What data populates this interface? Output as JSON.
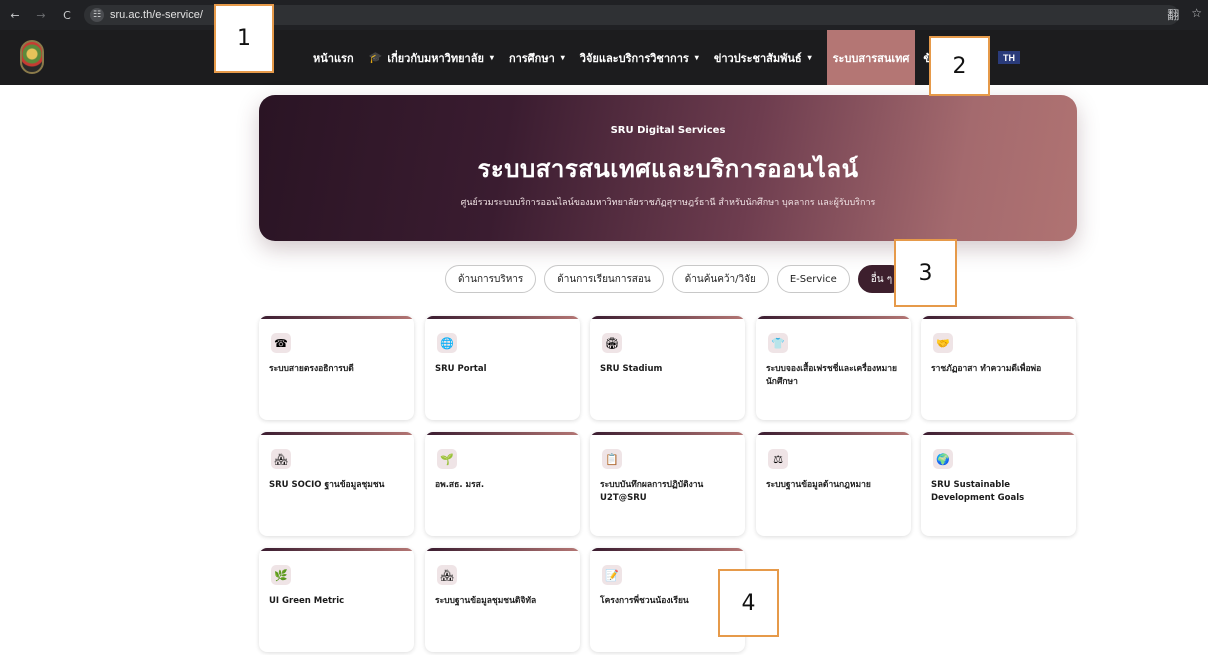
{
  "browser": {
    "url": "sru.ac.th/e-service/",
    "back_icon": "←",
    "forward_icon": "→",
    "reload_icon": "C",
    "site_info_icon": "☷",
    "translate_icon": "翻",
    "star_icon": "☆"
  },
  "nav": {
    "items": [
      {
        "label": "หน้าแรก"
      },
      {
        "label": "เกี่ยวกับมหาวิทยาลัย",
        "icon": "🎓",
        "caret": "▾"
      },
      {
        "label": "การศึกษา",
        "caret": "▾"
      },
      {
        "label": "วิจัยและบริการวิชาการ",
        "caret": "▾"
      },
      {
        "label": "ข่าวประชาสัมพันธ์",
        "caret": "▾"
      },
      {
        "label": "ระบบสารสนเทศ"
      },
      {
        "label": "ข้อ"
      }
    ],
    "lang_label": "TH"
  },
  "hero": {
    "eyebrow": "SRU Digital Services",
    "title": "ระบบสารสนเทศและบริการออนไลน์",
    "subtitle": "ศูนย์รวมระบบบริการออนไลน์ของมหาวิทยาลัยราชภัฏสุราษฎร์ธานี สำหรับนักศึกษา บุคลากร และผู้รับบริการ"
  },
  "filters": [
    {
      "label": "ด้านการบริหาร"
    },
    {
      "label": "ด้านการเรียนการสอน"
    },
    {
      "label": "ด้านค้นคว้า/วิจัย"
    },
    {
      "label": "E-Service"
    },
    {
      "label": "อื่น ๆ",
      "active": true
    }
  ],
  "cards": [
    {
      "icon": "☎",
      "label": "ระบบสายตรงอธิการบดี"
    },
    {
      "icon": "🌐",
      "label": "SRU Portal"
    },
    {
      "icon": "🏟",
      "label": "SRU Stadium"
    },
    {
      "icon": "👕",
      "label": "ระบบจองเสื้อเฟรชชี่และเครื่องหมายนักศึกษา"
    },
    {
      "icon": "🤝",
      "label": "ราชภัฏอาสา ทำความดีเพื่อพ่อ"
    },
    {
      "icon": "🏘",
      "label": "SRU SOCIO ฐานข้อมูลชุมชน"
    },
    {
      "icon": "🌱",
      "label": "อพ.สธ. มรส."
    },
    {
      "icon": "📋",
      "label": "ระบบบันทึกผลการปฏิบัติงาน U2T@SRU"
    },
    {
      "icon": "⚖",
      "label": "ระบบฐานข้อมูลด้านกฎหมาย"
    },
    {
      "icon": "🌍",
      "label": "SRU Sustainable Development Goals"
    },
    {
      "icon": "🌿",
      "label": "UI Green Metric"
    },
    {
      "icon": "🏘",
      "label": "ระบบฐานข้อมูลชุมชนดิจิทัล"
    },
    {
      "icon": "📝",
      "label": "โครงการพี่ชวนน้องเรียน"
    }
  ],
  "annotations": [
    "1",
    "2",
    "3",
    "4"
  ],
  "colors": {
    "accent": "#b47674",
    "hero_dark": "#2a1424",
    "chip_active": "#3d1f2d",
    "annotation_border": "#e69a4a"
  }
}
